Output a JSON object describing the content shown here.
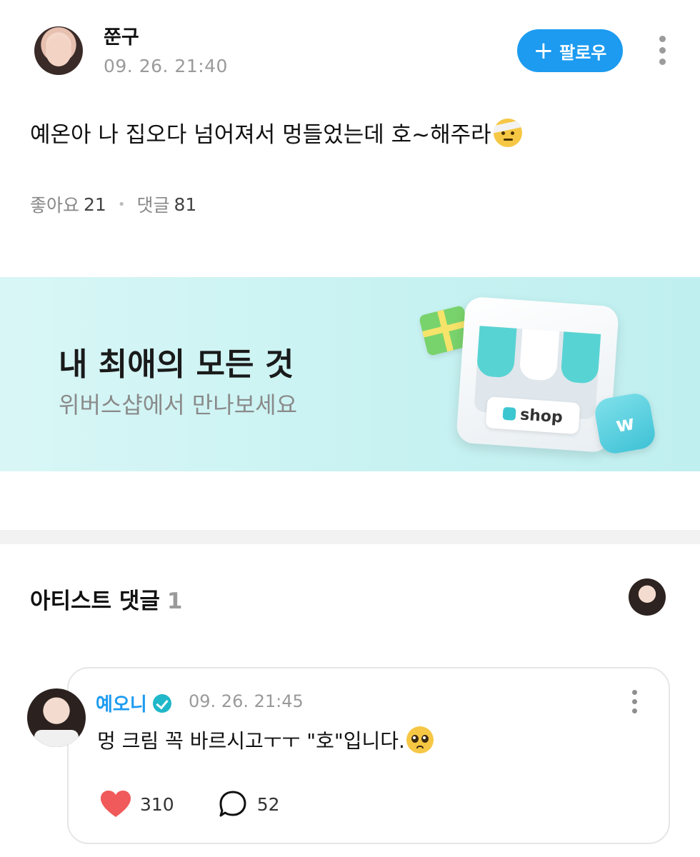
{
  "post": {
    "author": "쭌구",
    "time": "09. 26. 21:40",
    "follow_label": "팔로우",
    "follow_plus": "+",
    "text": "예온아 나 집오다 넘어져서 멍들었는데 호~해주라",
    "likes_label": "좋아요",
    "likes_count": "21",
    "sep": "•",
    "comments_label": "댓글",
    "comments_count": "81"
  },
  "banner": {
    "title": "내 최애의 모든 것",
    "subtitle": "위버스샵에서 만나보세요",
    "shop_label": "shop",
    "bag_letter": "w"
  },
  "artist_section": {
    "title": "아티스트 댓글",
    "count": "1"
  },
  "comment": {
    "name": "예오니",
    "time": "09. 26. 21:45",
    "text": "멍 크림 꼭 바르시고ㅜㅜ \"호\"입니다.",
    "likes": "310",
    "replies": "52"
  },
  "colors": {
    "accent": "#1c9bf0",
    "banner_bg": "#c8f2f2",
    "heart": "#f05a5a",
    "verified": "#20b7c9"
  },
  "icons": {
    "more": "more-vertical-icon",
    "verified": "verified-badge-icon",
    "like": "heart-icon",
    "reply": "speech-bubble-icon"
  }
}
